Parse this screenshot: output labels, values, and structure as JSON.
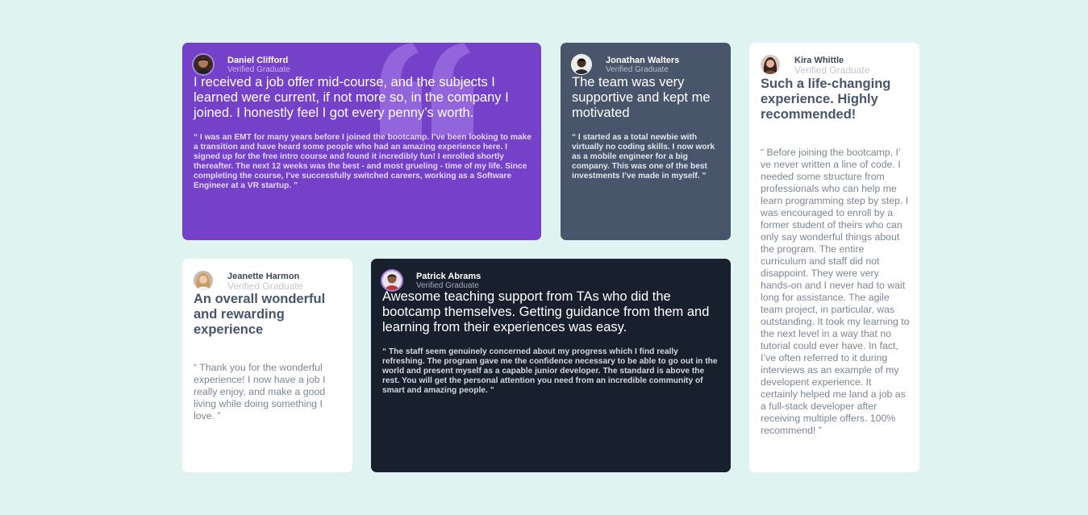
{
  "colors": {
    "background": "#dff3f1",
    "purple": "#7541c8",
    "slate": "#48556a",
    "white": "#ffffff",
    "dark": "#19202d"
  },
  "testimonials": [
    {
      "name": "Daniel Clifford",
      "role": "Verified Graduate",
      "headline": "I received a job offer mid-course, and the subjects I learned were current, if not more so, in the company I joined. I honestly feel I got every penny’s worth.",
      "body": "“ I was an EMT for many years before I joined the bootcamp. I’ve been looking to make a transition and have heard some people who had an amazing experience here. I signed up for the free intro course and found it incredibly fun! I enrolled shortly thereafter. The next 12 weeks was the best - and most grueling - time of my life. Since completing the course, I’ve successfully switched careers, working as a Software Engineer at a VR startup. ”"
    },
    {
      "name": "Jonathan Walters",
      "role": "Verified Graduate",
      "headline": "The team was very supportive and kept me motivated",
      "body": "“ I started as a total newbie with virtually no coding skills. I now work as a mobile engineer for a big company. This was one of the best investments I’ve made in myself. ”"
    },
    {
      "name": "Kira Whittle",
      "role": "Verified Graduate",
      "headline": "Such a life-changing experience. Highly recommended!",
      "body": "“ Before joining the bootcamp, I’ ve never written a line of code. I needed some structure from professionals who can help me learn programming step by step. I was encouraged to enroll by a former student of theirs who can only say wonderful things about the program. The entire curriculum and staff did not disappoint. They were very hands-on and I never had to wait long for assistance. The agile team project, in particular, was outstanding. It took my learning to the next level in a way that no tutorial could ever have. In fact, I’ve often referred to it during interviews as an example of my developent experience. It certainly helped me land a job as a full-stack developer after receiving multiple offers. 100% recommend! ”"
    },
    {
      "name": "Jeanette Harmon",
      "role": "Verified Graduate",
      "headline": "An overall wonderful and rewarding experience",
      "body": "“ Thank you for the wonderful experience! I now have a job I really enjoy, and make a good living while doing something I love. ”"
    },
    {
      "name": "Patrick Abrams",
      "role": "Verified Graduate",
      "headline": "Awesome teaching support from TAs who did the bootcamp themselves. Getting guidance from them and learning from their experiences was easy.",
      "body": "“ The staff seem genuinely concerned about my progress which I find really refreshing. The program gave me the confidence necessary to be able to go out in the world and present myself as a capable junior developer. The standard is above the rest. You will get the personal attention you need from an incredible community of smart and amazing people. ”"
    }
  ]
}
